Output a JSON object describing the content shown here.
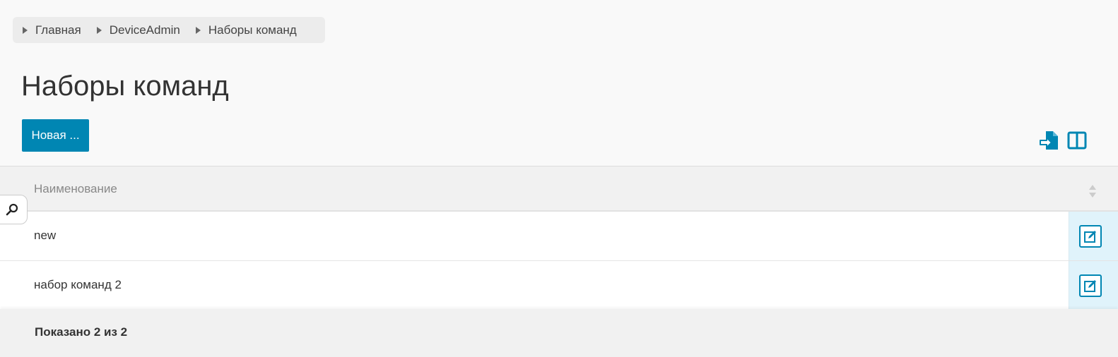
{
  "breadcrumb": {
    "items": [
      {
        "label": "Главная"
      },
      {
        "label": "DeviceAdmin"
      },
      {
        "label": "Наборы команд"
      }
    ]
  },
  "page": {
    "title": "Наборы команд"
  },
  "toolbar": {
    "new_label": "Новая ...",
    "icons": [
      "export-icon",
      "columns-icon"
    ]
  },
  "table": {
    "columns": [
      "Наименование"
    ],
    "rows": [
      {
        "name": "new"
      },
      {
        "name": "набор команд 2"
      }
    ]
  },
  "footer": {
    "status": "Показано 2 из 2"
  },
  "colors": {
    "accent": "#0086b3",
    "action_bg": "#e0f3fb",
    "header_bg": "#f1f1f1"
  }
}
